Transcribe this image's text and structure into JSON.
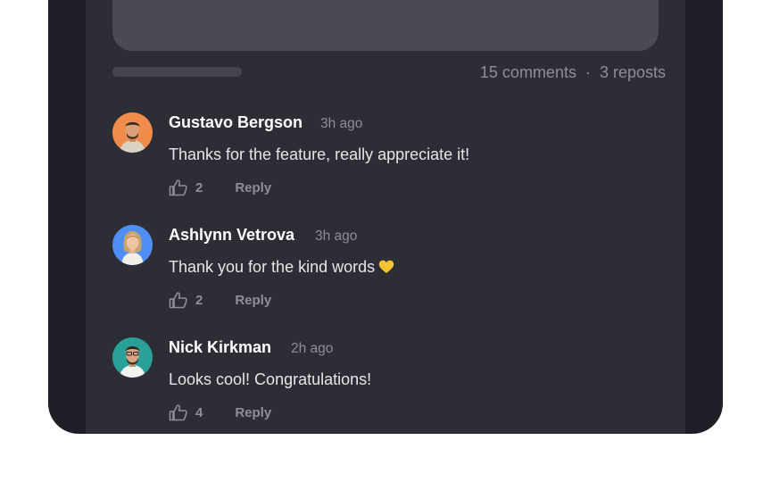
{
  "post": {
    "comments_count": "15 comments",
    "separator": "·",
    "reposts_count": "3 reposts"
  },
  "comments": [
    {
      "author": "Gustavo Bergson",
      "time": "3h ago",
      "text": "Thanks for the feature, really appreciate it!",
      "likes": "2",
      "reply_label": "Reply",
      "avatar_bg": "#f08c4b"
    },
    {
      "author": "Ashlynn Vetrova",
      "time": "3h ago",
      "text": "Thank you for the kind words",
      "emoji": "yellow-heart-icon",
      "likes": "2",
      "reply_label": "Reply",
      "avatar_bg": "#4f8ef5"
    },
    {
      "author": "Nick Kirkman",
      "time": "2h ago",
      "text": "Looks cool! Congratulations!",
      "likes": "4",
      "reply_label": "Reply",
      "avatar_bg": "#2aa198"
    }
  ]
}
